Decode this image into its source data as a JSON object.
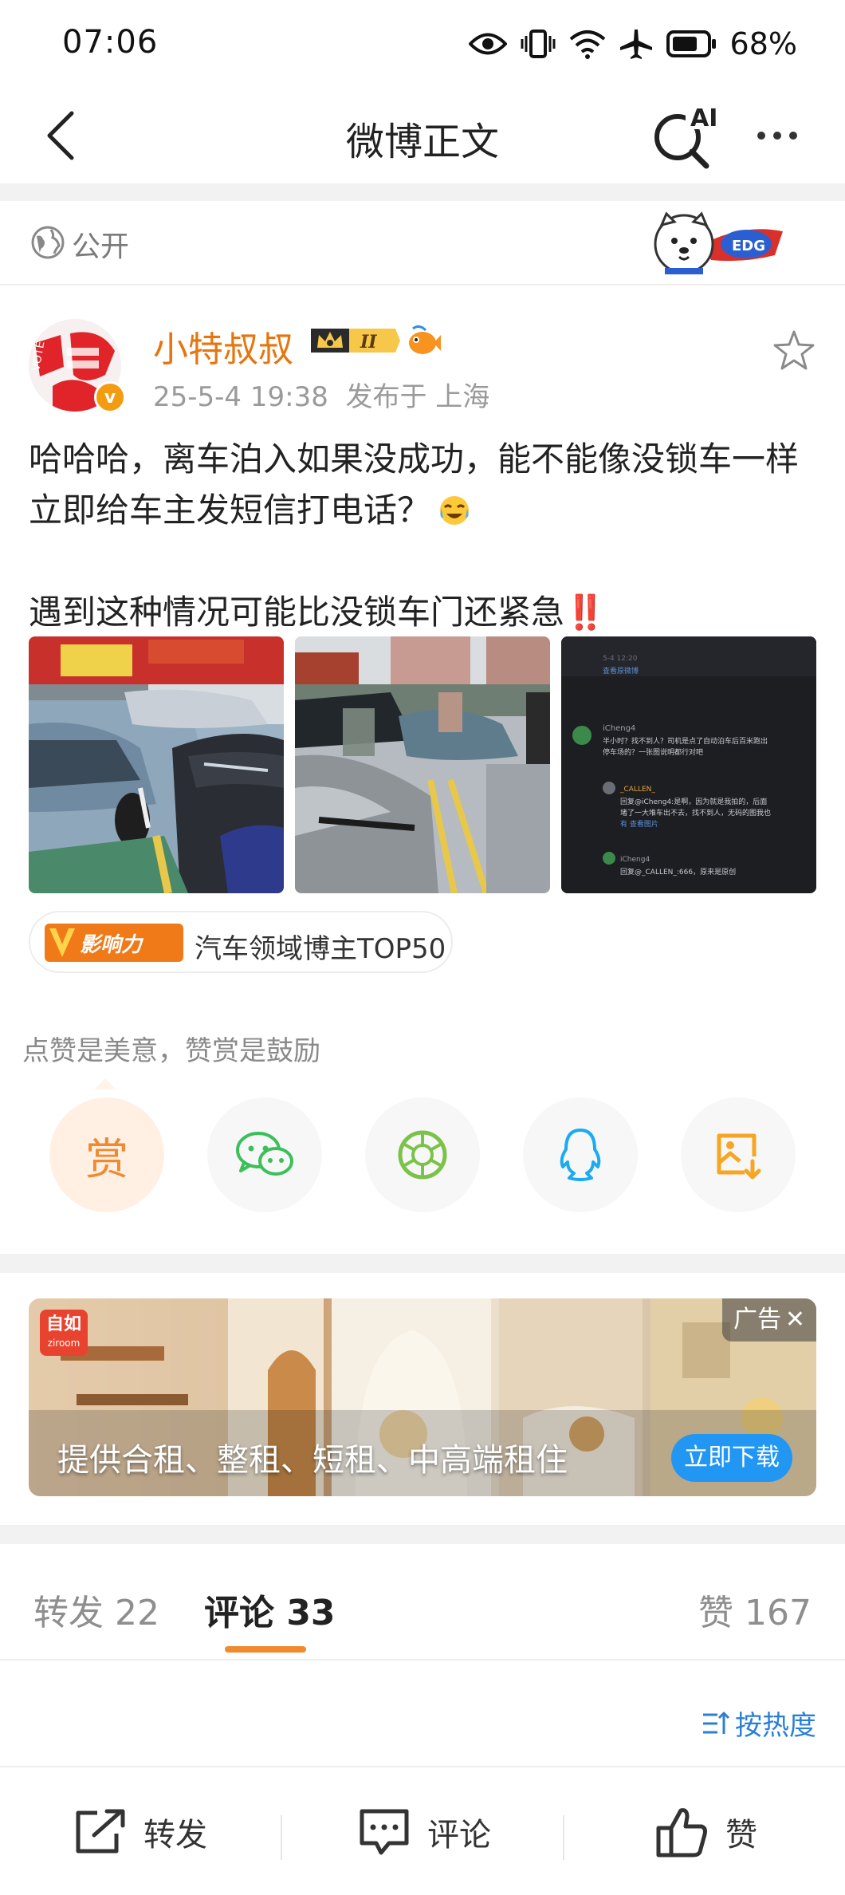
{
  "status_bar": {
    "time": "07:06",
    "battery": "68%"
  },
  "nav": {
    "title": "微博正文",
    "ai_label": "AI"
  },
  "visibility": {
    "label": "公开"
  },
  "post": {
    "author": "小特叔叔",
    "level_badge": "II",
    "timestamp": "25-5-4 19:38",
    "location": "发布于 上海",
    "text_line1": "哈哈哈，离车泊入如果没成功，能不能像没锁车一样立即给车主发短信打电话？",
    "text_line2": "遇到这种情况可能比没锁车门还紧急",
    "text_line2_emoji": "‼️",
    "influence_logo_text": "影响力",
    "influence_text": "汽车领域博主TOP50"
  },
  "screenshot_thumb": {
    "lines": [
      "iCheng4",
      "半小时？找不到人？司机是点了自动泊车后百米跑出",
      "停车场的？一张图说明都行对吧",
      "_CALLEN_",
      "回复@iCheng4:是啊，因为就是我拍的，后面",
      "堵了一大堆车出不去，找不到人，无码的图我也",
      "有 查看图片",
      "iCheng4",
      "回复@_CALLEN_:666，原来是原创"
    ]
  },
  "reward": {
    "tip": "点赞是美意，赞赏是鼓励",
    "reward_char": "赏"
  },
  "ad": {
    "logo_top": "自如",
    "logo_bottom": "ziroom",
    "tag": "广告",
    "close": "✕",
    "text": "提供合租、整租、短租、中高端租住",
    "button": "立即下载"
  },
  "tabs": {
    "repost": "转发 22",
    "comment": "评论 33",
    "like": "赞 167"
  },
  "sort": {
    "label": "按热度"
  },
  "actions": {
    "repost": "转发",
    "comment": "评论",
    "like": "赞"
  },
  "colors": {
    "accent_orange": "#f08a30",
    "author_orange": "#e8740e",
    "link_blue": "#2b7fd6",
    "ad_button_blue": "#2196f3",
    "wechat_green": "#3cbf5a",
    "qq_blue": "#1aabf0"
  }
}
